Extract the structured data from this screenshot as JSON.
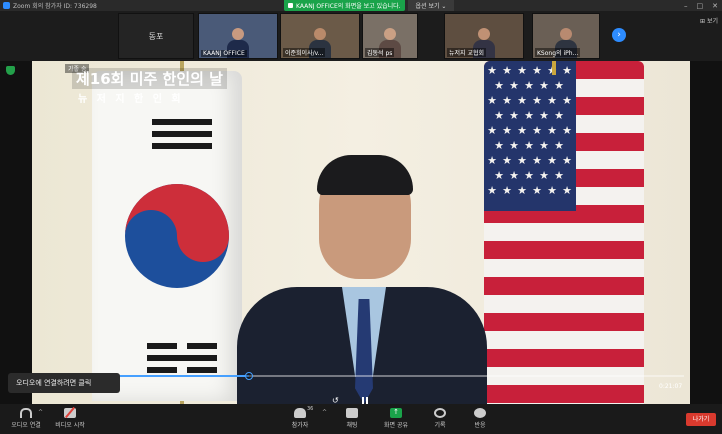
{
  "window": {
    "title": "Zoom 회의 참가자 ID: 736298",
    "controls": [
      "–",
      "□",
      "✕"
    ]
  },
  "share_banner": {
    "text": "KAANJ OFFICE의 화면을 보고 있습니다.",
    "view_options": "옵션 보기 ⌄"
  },
  "gallery": {
    "label_tile": "동포",
    "view_toggle": "⊞ 보기",
    "participants": [
      {
        "name": "KAANJ OFFICE"
      },
      {
        "name": "이준희이사/v..."
      },
      {
        "name": "김동석 ps"
      },
      {
        "name": "뉴저지 교협회"
      },
      {
        "name": "KSong의 iPh..."
      }
    ],
    "next_label": "›"
  },
  "video": {
    "speaker_label": "가좋 송",
    "event_title": "제16회 미주 한인의 날",
    "event_org": "뉴 저 지 한 인 회",
    "elapsed_time": "0:21:07",
    "progress_fraction": 0.31
  },
  "tooltip": {
    "audio_connect": "오디오에 연결하려면 클릭"
  },
  "toolbar": {
    "join_audio": "오디오 연결",
    "start_video": "비디오 시작",
    "participants": "참가자",
    "participants_count": "36",
    "chat": "채팅",
    "share_screen": "화면 공유",
    "record": "기록",
    "reactions": "반응",
    "leave": "나가기"
  },
  "colors": {
    "accent_blue": "#2d8cff",
    "share_green": "#1aa34a",
    "leave_red": "#d93a2e"
  }
}
